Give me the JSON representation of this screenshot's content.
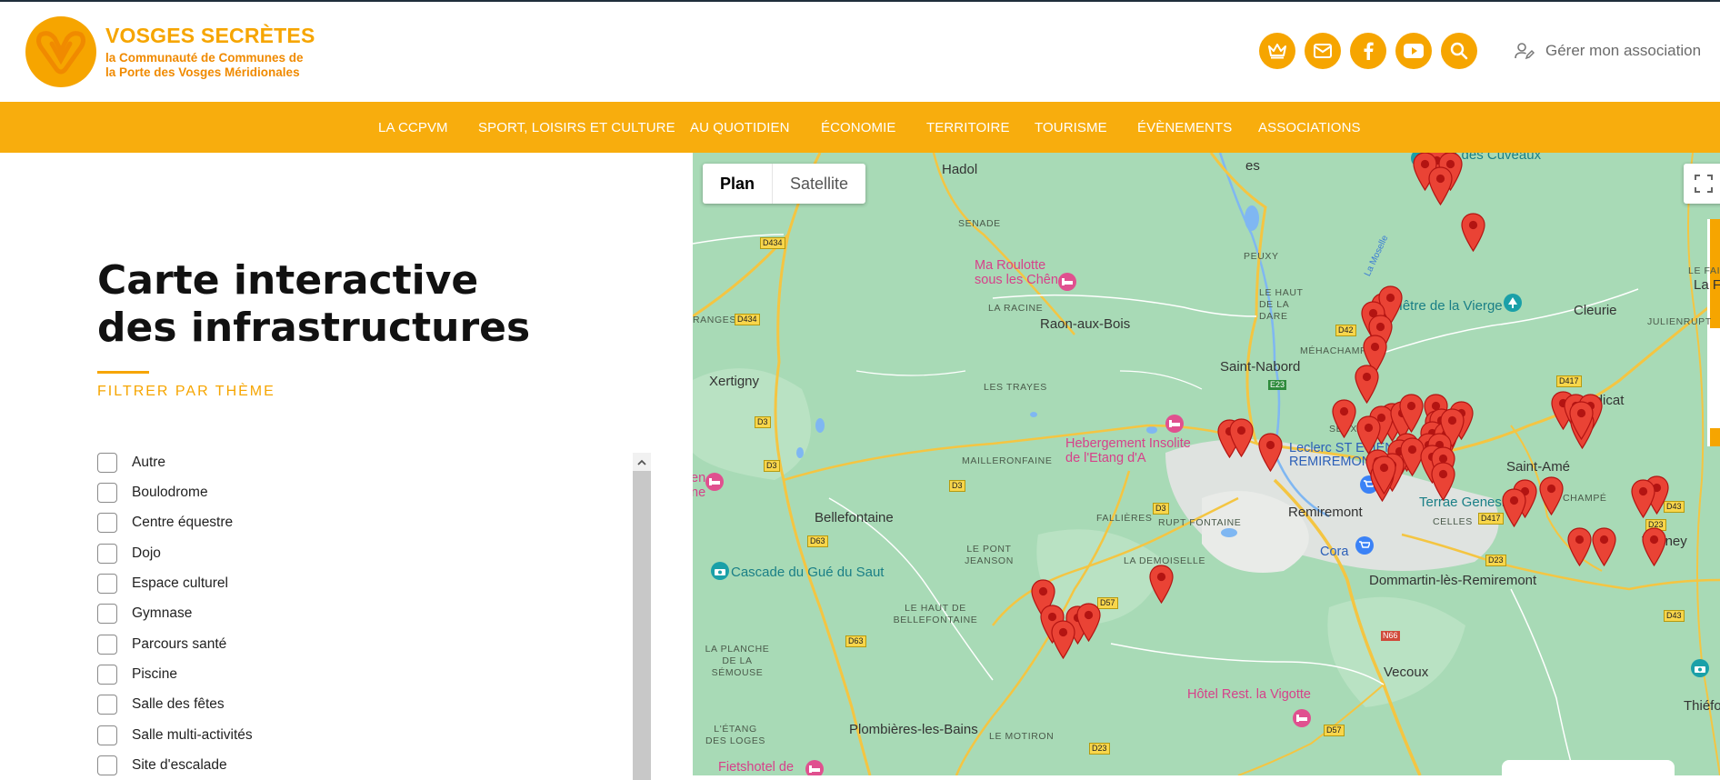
{
  "header": {
    "brand_title": "VOSGES SECRÈTES",
    "brand_subtitle": "la Communauté de Communes de\nla Porte des Vosges Méridionales",
    "manage_label": "Gérer mon association",
    "social_icons": [
      "crown-icon",
      "mail-icon",
      "facebook-icon",
      "youtube-icon",
      "search-icon"
    ]
  },
  "nav": {
    "items": [
      "LA CCPVM",
      "SPORT, LOISIRS ET CULTURE",
      "AU QUOTIDIEN",
      "ÉCONOMIE",
      "TERRITOIRE",
      "TOURISME",
      "ÉVÈNEMENTS",
      "ASSOCIATIONS"
    ]
  },
  "main": {
    "title": "Carte interactive des infrastructures",
    "filter_heading": "FILTRER PAR THÈME",
    "filters": [
      "Autre",
      "Boulodrome",
      "Centre équestre",
      "Dojo",
      "Espace culturel",
      "Gymnase",
      "Parcours santé",
      "Piscine",
      "Salle des fêtes",
      "Salle multi-activités",
      "Site d'escalade"
    ]
  },
  "map": {
    "type_buttons": [
      "Plan",
      "Satellite"
    ],
    "selected_type": "Plan",
    "towns": [
      "Hadol",
      "Raon-aux-Bois",
      "Xertigny",
      "Saint-Nabord",
      "Bellefontaine",
      "Remiremont",
      "Dommartin-lès-Remiremont",
      "Vecoux",
      "Saint-Amé",
      "Le Syndicat",
      "Vagney",
      "Cleurie",
      "La Fo",
      "Thiéfo",
      "Plombières-les-Bains",
      "es",
      "Remiremont"
    ],
    "localities": [
      "SENADE",
      "LA RACINE",
      "PEUXY",
      "LE HAUT DE LA DARE",
      "MÉHACHAMP",
      "LES TRAYES",
      "MAILLERONFAINE",
      "FALLIÈRES",
      "RUPT FONTAINE",
      "LE PONT JEANSON",
      "LA DEMOISELLE",
      "LE HAUT DE BELLEFONTAINE",
      "LA PLANCHE DE LA SÉMOUSE",
      "L'ÉTANG DES LOGES",
      "LE MOTIRON",
      "SEUX",
      "CELLES",
      "CHAMPÉ",
      "JULIENRUPT",
      "LE FAILLA",
      "RANGES"
    ],
    "pois": [
      "Ma Roulotte sous les Chênes",
      "Hebergement Insolite de l'Etang d'A",
      "Hôtel Rest. la Vigotte",
      "Fietshotel de",
      "Cascade du Gué du Saut",
      "Hêtre de la Vierge",
      "Terrae Genesis",
      "Roche des Cuveaux",
      "Leclerc ST ETIENNE LÈS REMIREMONT",
      "Cora",
      "en",
      "ne"
    ],
    "roads": [
      "D434",
      "D434",
      "D3",
      "D3",
      "D3",
      "D3",
      "D63",
      "D63",
      "D42",
      "E23",
      "D417",
      "D417",
      "D23",
      "D43",
      "D43",
      "D57",
      "D57",
      "D23",
      "N66",
      "D23"
    ],
    "river": "La Moselle",
    "marker_count": 58
  }
}
